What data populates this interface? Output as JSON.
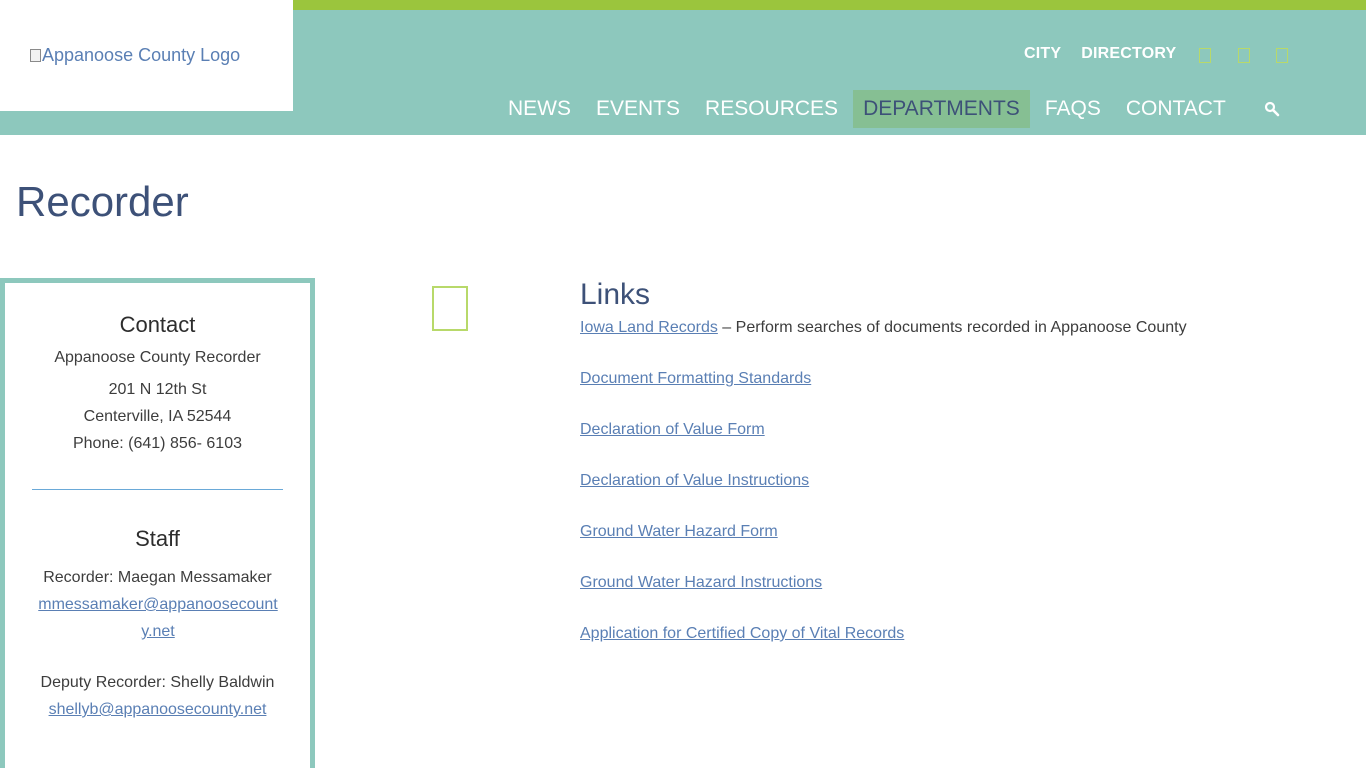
{
  "header": {
    "logo_alt": "Appanoose County Logo",
    "utility_nav": [
      "CITY",
      "DIRECTORY"
    ],
    "social_icons": [
      "facebook-icon",
      "twitter-icon",
      "email-icon"
    ],
    "main_nav": [
      {
        "label": "NEWS",
        "active": false
      },
      {
        "label": "EVENTS",
        "active": false
      },
      {
        "label": "RESOURCES",
        "active": false
      },
      {
        "label": "DEPARTMENTS",
        "active": true
      },
      {
        "label": "FAQS",
        "active": false
      },
      {
        "label": "CONTACT",
        "active": false
      }
    ],
    "search_icon": "search-icon"
  },
  "page": {
    "title": "Recorder"
  },
  "sidebar": {
    "contact": {
      "heading": "Contact",
      "name": "Appanoose County Recorder",
      "address1": "201 N 12th St",
      "address2": "Centerville, IA 52544",
      "phone": "Phone: (641) 856- 6103"
    },
    "staff": {
      "heading": "Staff",
      "members": [
        {
          "title": "Recorder: Maegan Messamaker",
          "email": "mmessamaker@appanoosecounty.net"
        },
        {
          "title": "Deputy Recorder: Shelly Baldwin",
          "email": "shellyb@appanoosecounty.net"
        }
      ]
    }
  },
  "links": {
    "heading": "Links",
    "items": [
      {
        "label": "Iowa Land Records",
        "description": " – Perform searches of documents recorded in Appanoose County"
      },
      {
        "label": "Document Formatting Standards",
        "description": ""
      },
      {
        "label": "Declaration of Value Form",
        "description": ""
      },
      {
        "label": "Declaration of Value Instructions",
        "description": ""
      },
      {
        "label": "Ground Water Hazard Form",
        "description": ""
      },
      {
        "label": "Ground Water Hazard Instructions",
        "description": ""
      },
      {
        "label": "Application for Certified Copy of Vital Records",
        "description": ""
      }
    ]
  },
  "colors": {
    "header_teal": "#8dc8bd",
    "accent_green": "#9bc53d",
    "active_nav_bg": "#86bf93",
    "heading_blue": "#3d5178",
    "link_blue": "#5a7fb4"
  }
}
